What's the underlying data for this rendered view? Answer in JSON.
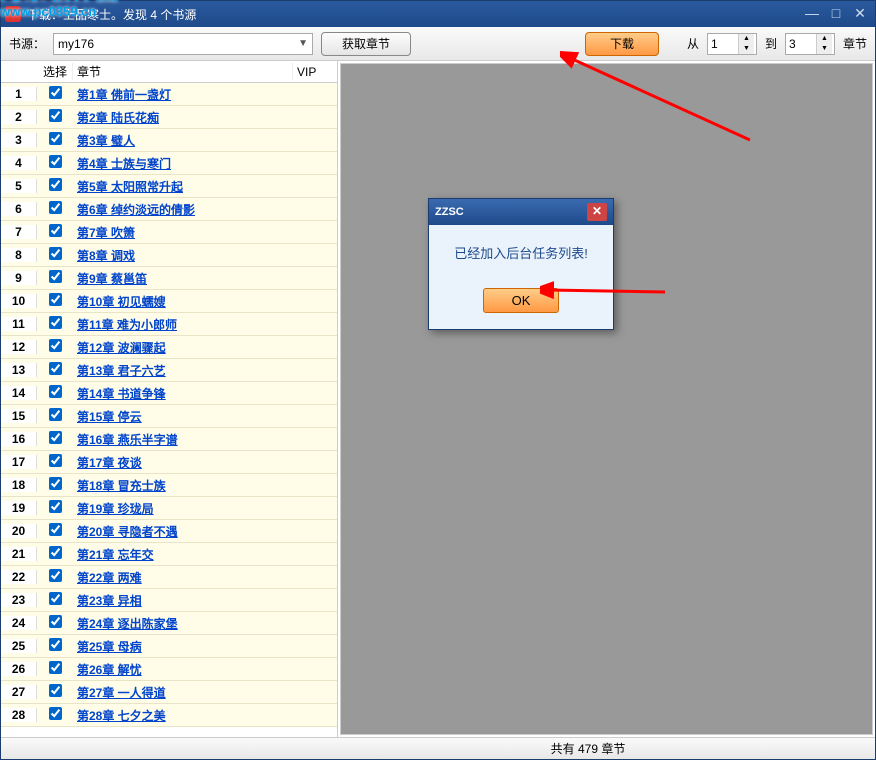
{
  "window": {
    "title": "下载：上品寒士。发现 4 个书源"
  },
  "watermark": {
    "text": "河东软件园",
    "url": "www.pc0359.cn"
  },
  "toolbar": {
    "source_label": "书源：",
    "source_value": "my176",
    "fetch_btn": "获取章节",
    "download_btn": "下载",
    "from_label": "从",
    "from_value": "1",
    "to_label": "到",
    "to_value": "3",
    "unit_label": "章节"
  },
  "table": {
    "headers": {
      "select": "选择",
      "chapter": "章节",
      "vip": "VIP"
    },
    "rows": [
      {
        "n": "1",
        "title": "第1章 佛前一盏灯"
      },
      {
        "n": "2",
        "title": "第2章 陆氏花痴"
      },
      {
        "n": "3",
        "title": "第3章 璧人"
      },
      {
        "n": "4",
        "title": "第4章 士族与寒门"
      },
      {
        "n": "5",
        "title": "第5章 太阳照常升起"
      },
      {
        "n": "6",
        "title": "第6章 绰约淡远的倩影"
      },
      {
        "n": "7",
        "title": "第7章 吹箫"
      },
      {
        "n": "8",
        "title": "第8章 调戏"
      },
      {
        "n": "9",
        "title": "第9章 蔡邕笛"
      },
      {
        "n": "10",
        "title": "第10章 初见蠕嫂"
      },
      {
        "n": "11",
        "title": "第11章 难为小郎师"
      },
      {
        "n": "12",
        "title": "第12章 波澜骤起"
      },
      {
        "n": "13",
        "title": "第13章 君子六艺"
      },
      {
        "n": "14",
        "title": "第14章 书道争锋"
      },
      {
        "n": "15",
        "title": "第15章 停云"
      },
      {
        "n": "16",
        "title": "第16章 燕乐半字谱"
      },
      {
        "n": "17",
        "title": "第17章 夜谈"
      },
      {
        "n": "18",
        "title": "第18章 冒充士族"
      },
      {
        "n": "19",
        "title": "第19章 珍珑局"
      },
      {
        "n": "20",
        "title": "第20章 寻隐者不遇"
      },
      {
        "n": "21",
        "title": "第21章 忘年交"
      },
      {
        "n": "22",
        "title": "第22章 两难"
      },
      {
        "n": "23",
        "title": "第23章 异相"
      },
      {
        "n": "24",
        "title": "第24章 逐出陈家堡"
      },
      {
        "n": "25",
        "title": "第25章 母病"
      },
      {
        "n": "26",
        "title": "第26章 解忧"
      },
      {
        "n": "27",
        "title": "第27章 一人得道"
      },
      {
        "n": "28",
        "title": "第28章 七夕之美"
      }
    ]
  },
  "dialog": {
    "title": "ZZSC",
    "message": "已经加入后台任务列表!",
    "ok": "OK"
  },
  "status": {
    "text": "共有 479 章节"
  }
}
